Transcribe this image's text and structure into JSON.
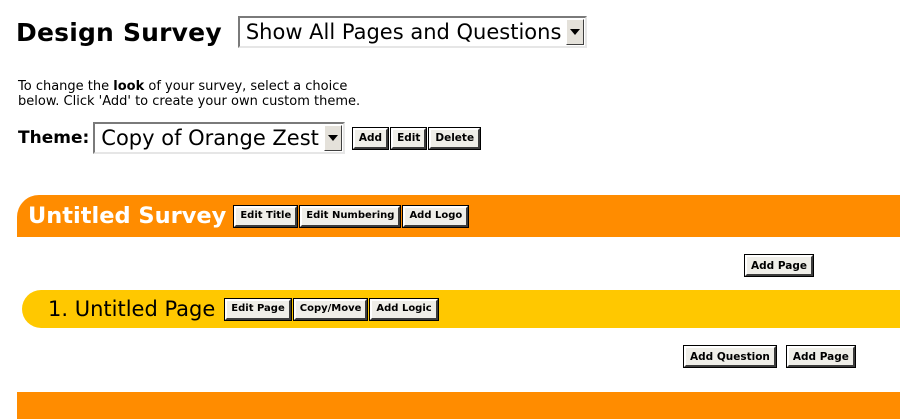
{
  "header": {
    "title": "Design Survey",
    "view_select_value": "Show All Pages and Questions"
  },
  "intro": {
    "line1_before": "To change the ",
    "line1_bold": "look",
    "line1_after": " of your survey, select a choice",
    "line2": "below.  Click 'Add' to create your own custom theme."
  },
  "theme": {
    "label": "Theme:",
    "select_value": "Copy of Orange Zest",
    "add_label": "Add",
    "edit_label": "Edit",
    "delete_label": "Delete"
  },
  "survey": {
    "title": "Untitled Survey",
    "edit_title_label": "Edit Title",
    "edit_numbering_label": "Edit Numbering",
    "add_logo_label": "Add Logo",
    "add_page_label": "Add Page"
  },
  "page": {
    "title": "1. Untitled Page",
    "edit_page_label": "Edit Page",
    "copy_move_label": "Copy/Move",
    "add_logic_label": "Add Logic",
    "add_question_label": "Add Question",
    "add_page_label": "Add Page"
  },
  "colors": {
    "survey_bar": "#ff8c00",
    "page_bar": "#ffc800"
  }
}
